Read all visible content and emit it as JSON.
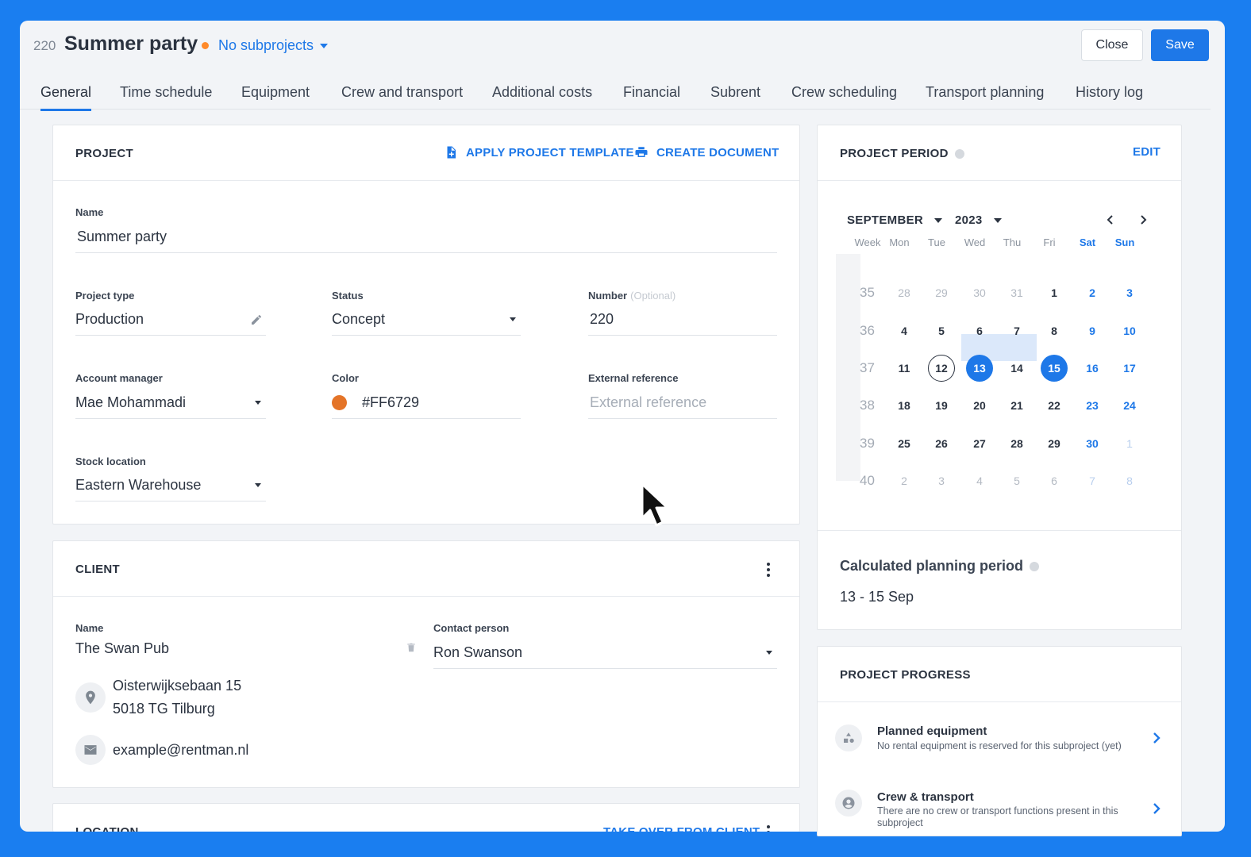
{
  "header": {
    "project_number": "220",
    "project_title": "Summer party",
    "status_dot_color": "#FF8A2A",
    "subprojects_label": "No subprojects",
    "close_label": "Close",
    "save_label": "Save"
  },
  "tabs": [
    {
      "label": "General",
      "active": true
    },
    {
      "label": "Time schedule"
    },
    {
      "label": "Equipment"
    },
    {
      "label": "Crew and transport"
    },
    {
      "label": "Additional costs"
    },
    {
      "label": "Financial"
    },
    {
      "label": "Subrent"
    },
    {
      "label": "Crew scheduling"
    },
    {
      "label": "Transport planning"
    },
    {
      "label": "History log"
    }
  ],
  "project_card": {
    "title": "PROJECT",
    "apply_template_label": "APPLY PROJECT TEMPLATE",
    "create_document_label": "CREATE DOCUMENT",
    "name_label": "Name",
    "name_value": "Summer party",
    "project_type_label": "Project type",
    "project_type_value": "Production",
    "status_label": "Status",
    "status_value": "Concept",
    "number_label": "Number",
    "number_optional": "(Optional)",
    "number_value": "220",
    "account_manager_label": "Account manager",
    "account_manager_value": "Mae Mohammadi",
    "color_label": "Color",
    "color_value": "#FF6729",
    "color_swatch": "#E47428",
    "external_reference_label": "External reference",
    "external_reference_placeholder": "External reference",
    "stock_location_label": "Stock location",
    "stock_location_value": "Eastern Warehouse"
  },
  "client_card": {
    "title": "CLIENT",
    "name_label": "Name",
    "name_value": "The Swan Pub",
    "contact_label": "Contact person",
    "contact_value": "Ron Swanson",
    "address_line1": "Oisterwijksebaan 15",
    "address_line2": "5018 TG Tilburg",
    "email": "example@rentman.nl"
  },
  "location_card": {
    "title": "LOCATION",
    "take_over_label": "TAKE OVER FROM CLIENT"
  },
  "period_card": {
    "title": "PROJECT PERIOD",
    "edit_label": "EDIT",
    "month": "SEPTEMBER",
    "year": "2023",
    "dow": [
      "Week",
      "Mon",
      "Tue",
      "Wed",
      "Thu",
      "Fri",
      "Sat",
      "Sun"
    ],
    "weeks": [
      {
        "num": "35",
        "days": [
          [
            "28",
            "m"
          ],
          [
            "29",
            "m"
          ],
          [
            "30",
            "m"
          ],
          [
            "31",
            "m"
          ],
          [
            "1",
            ""
          ],
          [
            "2",
            "w"
          ],
          [
            "3",
            "w"
          ]
        ]
      },
      {
        "num": "36",
        "days": [
          [
            "4",
            ""
          ],
          [
            "5",
            ""
          ],
          [
            "6",
            ""
          ],
          [
            "7",
            ""
          ],
          [
            "8",
            ""
          ],
          [
            "9",
            "w"
          ],
          [
            "10",
            "w"
          ]
        ]
      },
      {
        "num": "37",
        "days": [
          [
            "11",
            ""
          ],
          [
            "12",
            "t"
          ],
          [
            "13",
            "s"
          ],
          [
            "14",
            ""
          ],
          [
            "15",
            "s"
          ],
          [
            "16",
            "w"
          ],
          [
            "17",
            "w"
          ]
        ]
      },
      {
        "num": "38",
        "days": [
          [
            "18",
            ""
          ],
          [
            "19",
            ""
          ],
          [
            "20",
            ""
          ],
          [
            "21",
            ""
          ],
          [
            "22",
            ""
          ],
          [
            "23",
            "w"
          ],
          [
            "24",
            "w"
          ]
        ]
      },
      {
        "num": "39",
        "days": [
          [
            "25",
            ""
          ],
          [
            "26",
            ""
          ],
          [
            "27",
            ""
          ],
          [
            "28",
            ""
          ],
          [
            "29",
            ""
          ],
          [
            "30",
            "w"
          ],
          [
            "1",
            "wm"
          ]
        ]
      },
      {
        "num": "40",
        "days": [
          [
            "2",
            "m"
          ],
          [
            "3",
            "m"
          ],
          [
            "4",
            "m"
          ],
          [
            "5",
            "m"
          ],
          [
            "6",
            "m"
          ],
          [
            "7",
            "wm"
          ],
          [
            "8",
            "wm"
          ]
        ]
      }
    ],
    "calculated_label": "Calculated planning period",
    "calculated_value": "13 - 15 Sep"
  },
  "progress_card": {
    "title": "PROJECT PROGRESS",
    "items": [
      {
        "title": "Planned equipment",
        "desc": "No rental equipment is reserved for this subproject (yet)"
      },
      {
        "title": "Crew & transport",
        "desc": "There are no crew or transport functions present in this subproject"
      }
    ]
  }
}
